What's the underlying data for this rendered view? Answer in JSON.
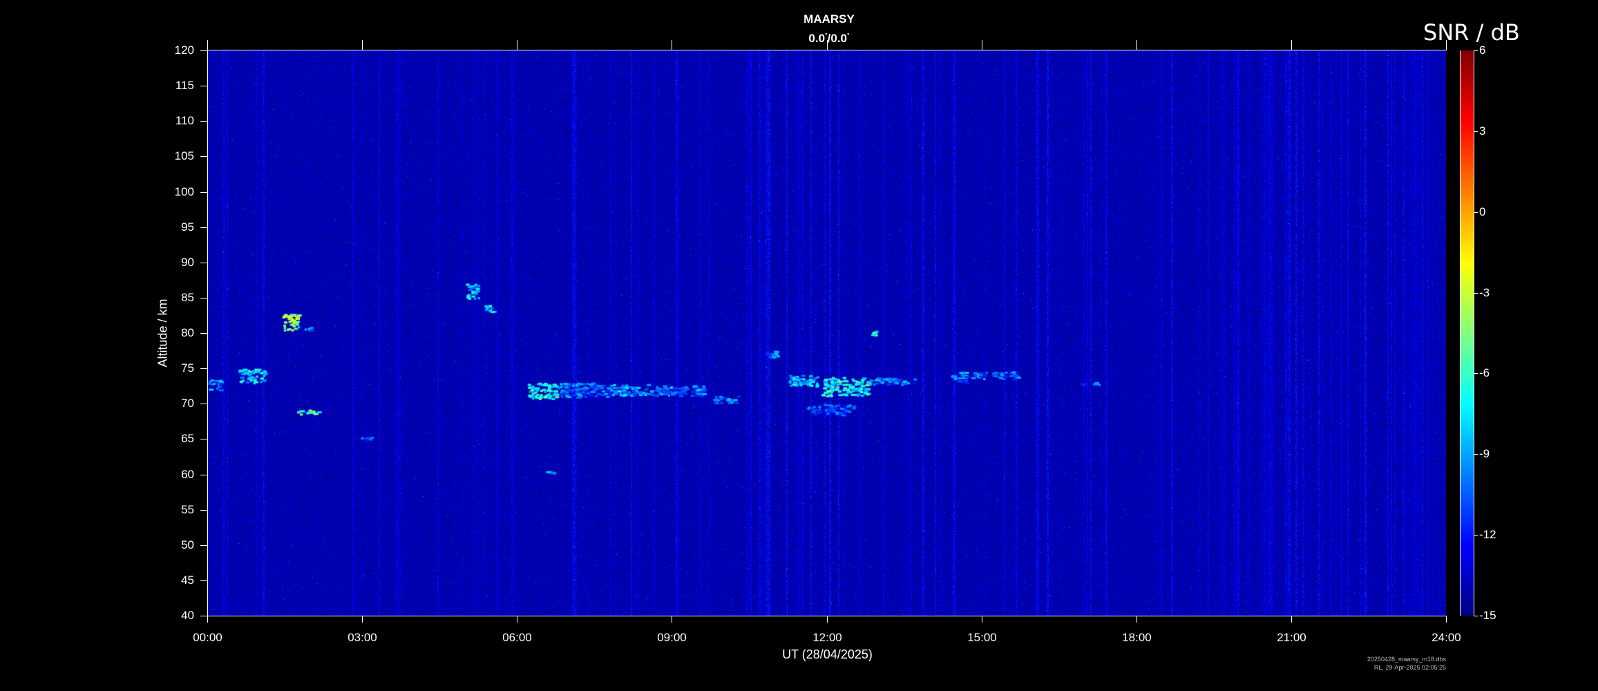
{
  "title": "MAARSY",
  "subtitle_main": "0.0",
  "subtitle_deg1": "°",
  "subtitle_sep": "/0.0",
  "subtitle_deg2": "°",
  "colorbar_title": "SNR / dB",
  "footer": {
    "line1": "20250428_maarsy_m18.dbs",
    "line2": "RL, 29-Apr-2025 02:05:25"
  },
  "chart_data": {
    "type": "heatmap",
    "title": "MAARSY",
    "xlabel": "UT (28/04/2025)",
    "ylabel": "Altitude / km",
    "x_unit": "hours UT",
    "xlim": [
      0,
      24
    ],
    "ylim": [
      40,
      120
    ],
    "x_ticks": [
      "00:00",
      "03:00",
      "06:00",
      "09:00",
      "12:00",
      "15:00",
      "18:00",
      "21:00",
      "24:00"
    ],
    "y_ticks": [
      40,
      45,
      50,
      55,
      60,
      65,
      70,
      75,
      80,
      85,
      90,
      95,
      100,
      105,
      110,
      115,
      120
    ],
    "colorbar": {
      "label": "SNR / dB",
      "range": [
        -15,
        6
      ],
      "ticks": [
        6,
        3,
        0,
        -3,
        -6,
        -9,
        -12,
        -15
      ],
      "colormap": "jet"
    },
    "background_snr_db": -14,
    "echo_regions": [
      {
        "t_start": 0.0,
        "t_end": 0.25,
        "alt_min": 72.0,
        "alt_max": 73.5,
        "snr_db": -8
      },
      {
        "t_start": 0.6,
        "t_end": 1.1,
        "alt_min": 73.0,
        "alt_max": 75.0,
        "snr_db": -6
      },
      {
        "t_start": 1.45,
        "t_end": 1.75,
        "alt_min": 80.5,
        "alt_max": 82.8,
        "snr_db": -2
      },
      {
        "t_start": 1.75,
        "t_end": 2.0,
        "alt_min": 80.5,
        "alt_max": 81.0,
        "snr_db": -7
      },
      {
        "t_start": 1.7,
        "t_end": 2.15,
        "alt_min": 68.6,
        "alt_max": 69.2,
        "snr_db": -4
      },
      {
        "t_start": 2.95,
        "t_end": 3.2,
        "alt_min": 64.8,
        "alt_max": 65.4,
        "snr_db": -9
      },
      {
        "t_start": 5.0,
        "t_end": 5.25,
        "alt_min": 85.0,
        "alt_max": 87.0,
        "snr_db": -6
      },
      {
        "t_start": 5.3,
        "t_end": 5.55,
        "alt_min": 83.0,
        "alt_max": 84.0,
        "snr_db": -6
      },
      {
        "t_start": 6.2,
        "t_end": 6.75,
        "alt_min": 70.8,
        "alt_max": 73.0,
        "snr_db": -5
      },
      {
        "t_start": 6.55,
        "t_end": 6.7,
        "alt_min": 60.2,
        "alt_max": 60.8,
        "snr_db": -7
      },
      {
        "t_start": 6.75,
        "t_end": 7.8,
        "alt_min": 71.0,
        "alt_max": 73.0,
        "snr_db": -8
      },
      {
        "t_start": 7.8,
        "t_end": 8.5,
        "alt_min": 71.2,
        "alt_max": 72.8,
        "snr_db": -7
      },
      {
        "t_start": 8.5,
        "t_end": 9.6,
        "alt_min": 71.2,
        "alt_max": 72.8,
        "snr_db": -8
      },
      {
        "t_start": 9.8,
        "t_end": 10.3,
        "alt_min": 70.2,
        "alt_max": 71.2,
        "snr_db": -8
      },
      {
        "t_start": 10.8,
        "t_end": 11.05,
        "alt_min": 76.6,
        "alt_max": 77.6,
        "snr_db": -8
      },
      {
        "t_start": 11.2,
        "t_end": 11.8,
        "alt_min": 72.5,
        "alt_max": 74.2,
        "snr_db": -6
      },
      {
        "t_start": 11.9,
        "t_end": 12.8,
        "alt_min": 71.2,
        "alt_max": 73.8,
        "snr_db": -5
      },
      {
        "t_start": 12.8,
        "t_end": 13.7,
        "alt_min": 72.8,
        "alt_max": 73.8,
        "snr_db": -8
      },
      {
        "t_start": 11.6,
        "t_end": 12.5,
        "alt_min": 68.5,
        "alt_max": 70.0,
        "snr_db": -9
      },
      {
        "t_start": 12.8,
        "t_end": 12.95,
        "alt_min": 79.8,
        "alt_max": 80.4,
        "snr_db": -5
      },
      {
        "t_start": 14.4,
        "t_end": 14.7,
        "alt_min": 73.0,
        "alt_max": 74.6,
        "snr_db": -8
      },
      {
        "t_start": 14.8,
        "t_end": 15.7,
        "alt_min": 73.6,
        "alt_max": 74.6,
        "snr_db": -8
      },
      {
        "t_start": 16.9,
        "t_end": 17.3,
        "alt_min": 72.8,
        "alt_max": 73.2,
        "snr_db": -9
      }
    ]
  }
}
